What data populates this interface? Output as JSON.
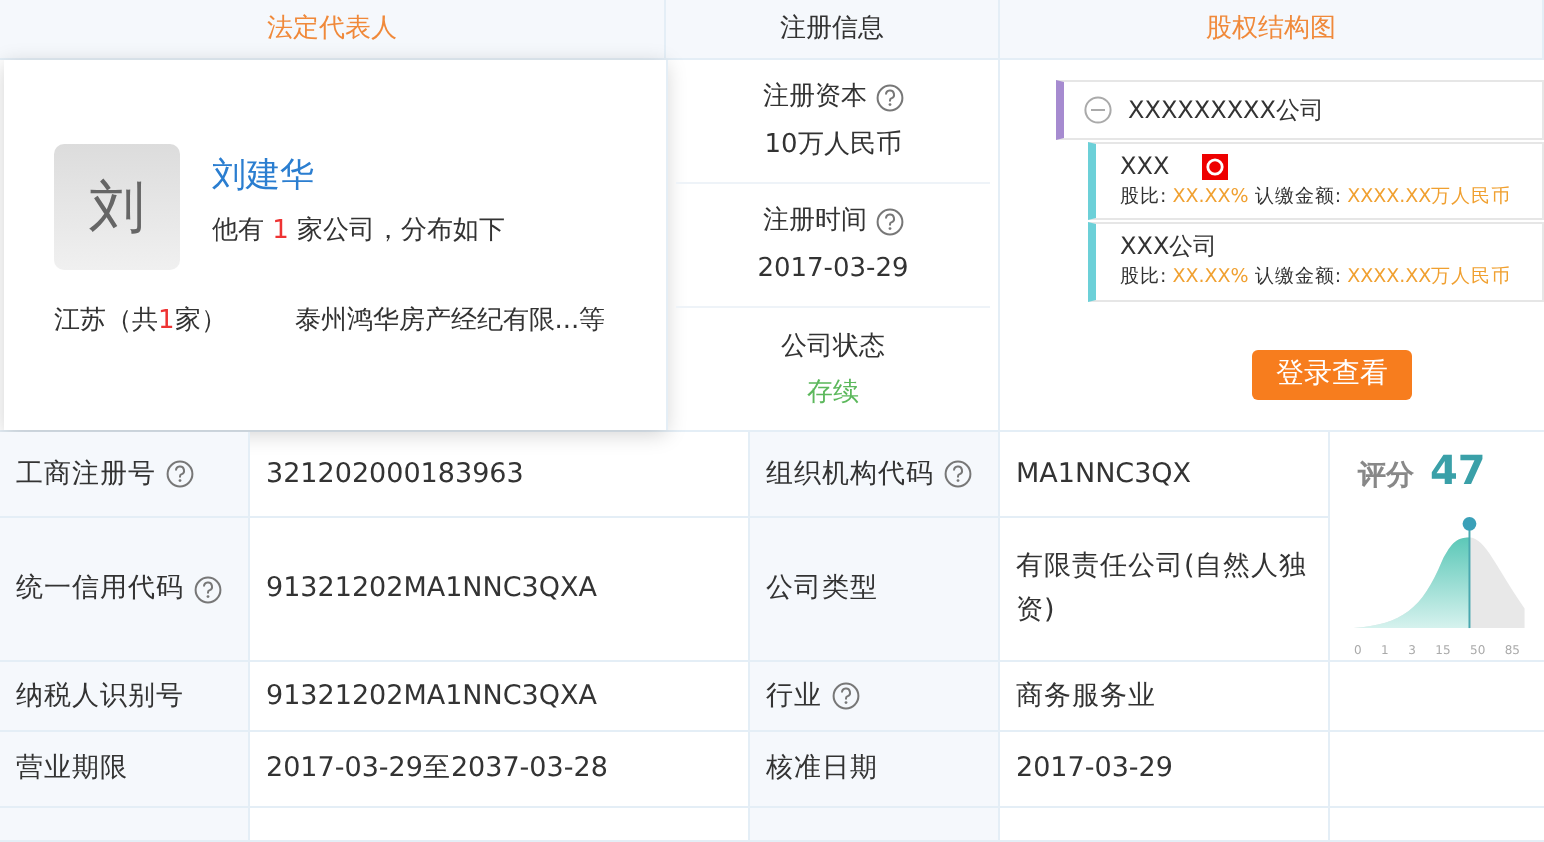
{
  "header": [
    {
      "label": "法定代表人",
      "highlighted": true
    },
    {
      "label": "注册信息",
      "highlighted": false
    },
    {
      "label": "股权结构图",
      "highlighted": true
    }
  ],
  "person_card": {
    "avatar": "刘",
    "name": "刘建华",
    "summary_before": "他有",
    "count": "1",
    "summary_after": "家公司，分布如下",
    "region_before": "江苏（共",
    "region_count": "1",
    "region_after": "家）",
    "companies": "泰州鸿华房产经纪有限...等"
  },
  "registration": [
    {
      "label": "注册资本",
      "help": true,
      "value": "10万人民币",
      "kind": "plain"
    },
    {
      "label": "注册时间",
      "help": true,
      "value": "2017-03-29",
      "kind": "plain"
    },
    {
      "label": "公司状态",
      "help": false,
      "value": "存续",
      "kind": "status"
    }
  ],
  "equity": {
    "root": "XXXXXXXXX公司",
    "expanded": true,
    "children": [
      {
        "name": "XXX",
        "tagged": true,
        "ratio_label": "股比:",
        "ratio": "XX.XX%",
        "amount_label": "认缴金额:",
        "amount": "XXXX.XX万人民币"
      },
      {
        "name": "XXX公司",
        "tagged": false,
        "ratio_label": "股比:",
        "ratio": "XX.XX%",
        "amount_label": "认缴金额:",
        "amount": "XXXX.XX万人民币"
      }
    ],
    "login_button": "登录查看"
  },
  "score": {
    "label": "评分",
    "value": "47",
    "ticks": [
      "0",
      "1",
      "3",
      "15",
      "50",
      "85"
    ]
  },
  "table": [
    {
      "label": "工商注册号",
      "help": true,
      "value": "321202000183963",
      "label2": "组织机构代码",
      "help2": true,
      "value2": "MA1NNC3QX"
    },
    {
      "label": "统一信用代码",
      "help": true,
      "value": "91321202MA1NNC3QXA",
      "label2": "公司类型",
      "help2": false,
      "value2": "有限责任公司(自然人独资)"
    },
    {
      "label": "纳税人识别号",
      "help": false,
      "value": "91321202MA1NNC3QXA",
      "label2": "行业",
      "help2": true,
      "value2": "商务服务业"
    },
    {
      "label": "营业期限",
      "help": false,
      "value": "2017-03-29至2037-03-28",
      "label2": "核准日期",
      "help2": false,
      "value2": "2017-03-29"
    }
  ]
}
